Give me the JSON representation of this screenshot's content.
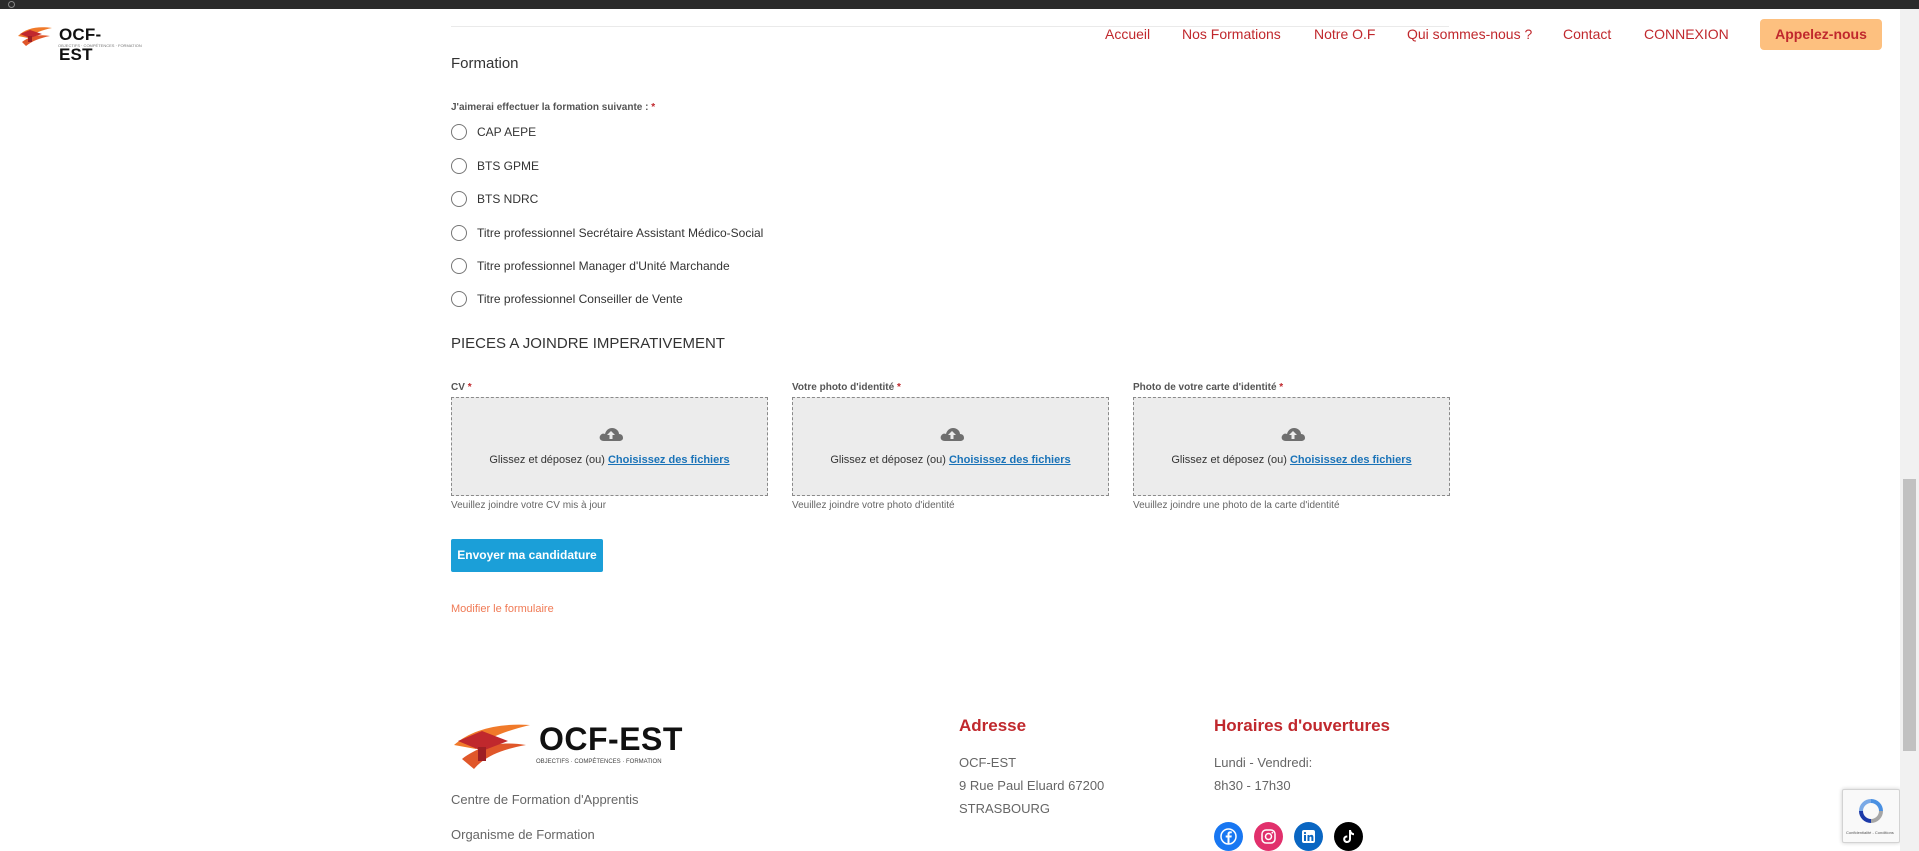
{
  "header": {
    "logo_text": "OCF-EST",
    "logo_tagline": "OBJECTIFS · COMPÉTENCES · FORMATION",
    "nav": [
      "Accueil",
      "Nos Formations",
      "Notre O.F",
      "Qui sommes-nous ?",
      "Contact",
      "CONNEXION"
    ],
    "cta_label": "Appelez-nous"
  },
  "form": {
    "formation_section_title": "Formation",
    "formation_question": "J'aimerai effectuer la formation suivante :",
    "required_mark": "*",
    "formation_options": [
      "CAP AEPE",
      "BTS GPME",
      "BTS NDRC",
      "Titre professionnel Secrétaire Assistant Médico-Social",
      "Titre professionnel Manager d'Unité Marchande",
      "Titre professionnel Conseiller de Vente"
    ],
    "pieces_section_title": "PIECES A JOINDRE IMPERATIVEMENT",
    "uploads": [
      {
        "label": "CV",
        "dz_text": "Glissez et déposez (ou)",
        "dz_link": "Choisissez des fichiers",
        "help": "Veuillez joindre votre CV mis à jour"
      },
      {
        "label": "Votre photo d'identité",
        "dz_text": "Glissez et déposez (ou)",
        "dz_link": "Choisissez des fichiers",
        "help": "Veuillez joindre votre photo d'identité"
      },
      {
        "label": "Photo de votre carte d'identité",
        "dz_text": "Glissez et déposez (ou)",
        "dz_link": "Choisissez des fichiers",
        "help": "Veuillez joindre une photo de la carte d'identité"
      }
    ],
    "submit_label": "Envoyer ma candidature",
    "edit_link": "Modifier le formulaire"
  },
  "footer": {
    "logo_text": "OCF-EST",
    "logo_tagline": "OBJECTIFS · COMPÉTENCES · FORMATION",
    "links": [
      "Centre de Formation d'Apprentis",
      "Organisme de Formation"
    ],
    "address_title": "Adresse",
    "address_lines": [
      "OCF-EST",
      "9 Rue Paul Eluard 67200",
      "STRASBOURG"
    ],
    "hours_title": "Horaires d'ouvertures",
    "hours_lines": [
      "Lundi - Vendredi:",
      "8h30 - 17h30"
    ],
    "social": [
      {
        "name": "facebook-icon",
        "color": "#1877f2"
      },
      {
        "name": "instagram-icon",
        "color": "#e1306c"
      },
      {
        "name": "linkedin-icon",
        "color": "#0a66c2"
      },
      {
        "name": "tiktok-icon",
        "color": "#000000"
      }
    ]
  },
  "recaptcha": {
    "privacy_text": "Confidentialité - Conditions"
  },
  "colors": {
    "brand_red": "#c0282d",
    "cta_bg": "#fdc07f",
    "submit_bg": "#1b9fd8",
    "link_blue": "#1a73b8",
    "edit_link": "#f07a55"
  }
}
